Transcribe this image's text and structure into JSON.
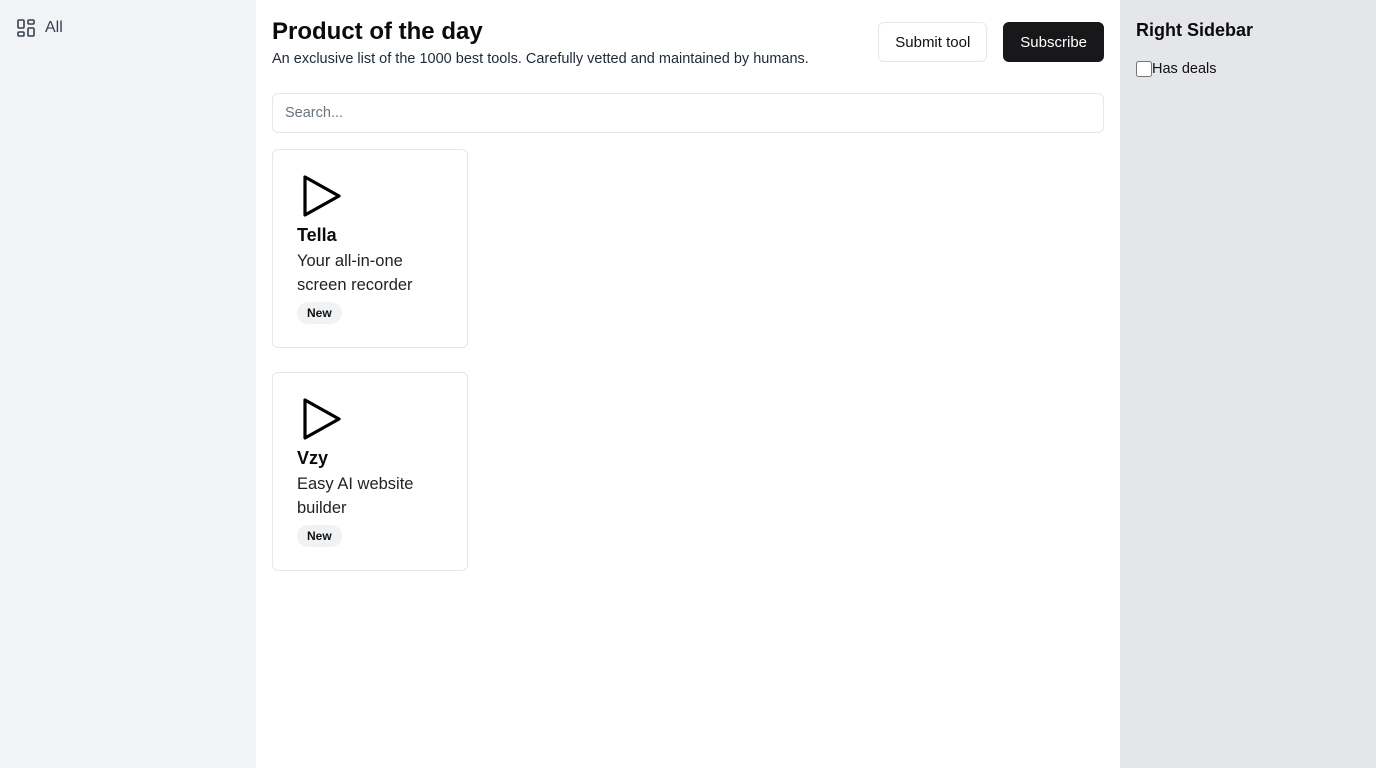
{
  "left_sidebar": {
    "items": [
      {
        "label": "All",
        "icon": "grid-icon"
      }
    ]
  },
  "header": {
    "title": "Product of the day",
    "subtitle": "An exclusive list of the 1000 best tools. Carefully vetted and maintained by humans.",
    "submit_label": "Submit tool",
    "subscribe_label": "Subscribe"
  },
  "search": {
    "placeholder": "Search...",
    "value": ""
  },
  "cards": [
    {
      "name": "Tella",
      "description": "Your all-in-one screen recorder",
      "badge": "New",
      "icon": "play-icon"
    },
    {
      "name": "Vzy",
      "description": "Easy AI website builder",
      "badge": "New",
      "icon": "play-icon"
    }
  ],
  "right_sidebar": {
    "title": "Right Sidebar",
    "filter_label": "Has deals",
    "filter_checked": false
  }
}
